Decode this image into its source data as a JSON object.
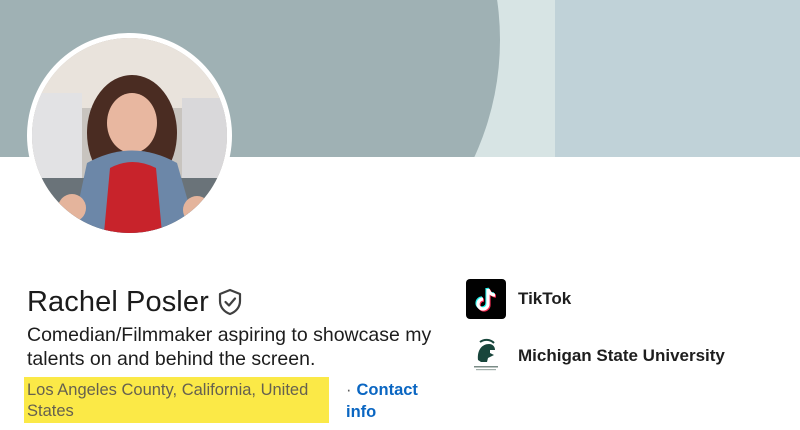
{
  "profile": {
    "name": "Rachel Posler",
    "headline": "Comedian/Filmmaker aspiring to showcase my talents on and behind the screen.",
    "location": "Los Angeles County, California, United States",
    "contact_separator": "·",
    "contact_label": "Contact info"
  },
  "organizations": [
    {
      "name": "TikTok",
      "logo": "tiktok-logo"
    },
    {
      "name": "Michigan State University",
      "logo": "spartan-helmet-logo"
    }
  ],
  "icons": {
    "verified": "shield-check-icon"
  },
  "colors": {
    "link": "#0a66c2",
    "highlight": "#fbe947",
    "banner": "#c0d2d8",
    "banner_dark": "#9fb1b4"
  }
}
